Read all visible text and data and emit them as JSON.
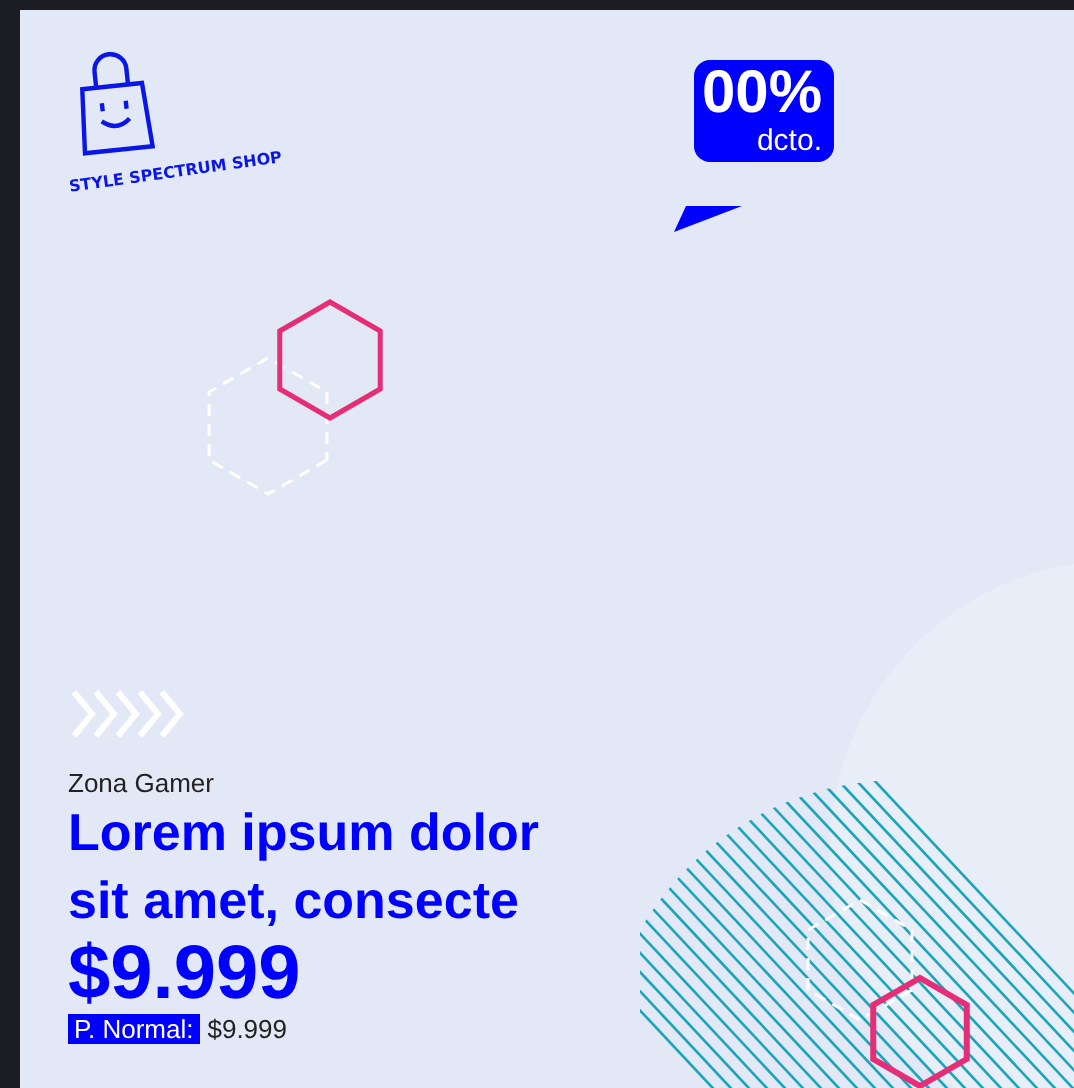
{
  "brand": {
    "name": "STYLE SPECTRUM SHOP"
  },
  "discount": {
    "value": "00%",
    "suffix": "dcto."
  },
  "product": {
    "category": "Zona Gamer",
    "title": "Lorem ipsum dolor sit amet, consecte",
    "price": "$9.999",
    "normal_label": "P. Normal:",
    "normal_price": "$9.999"
  }
}
